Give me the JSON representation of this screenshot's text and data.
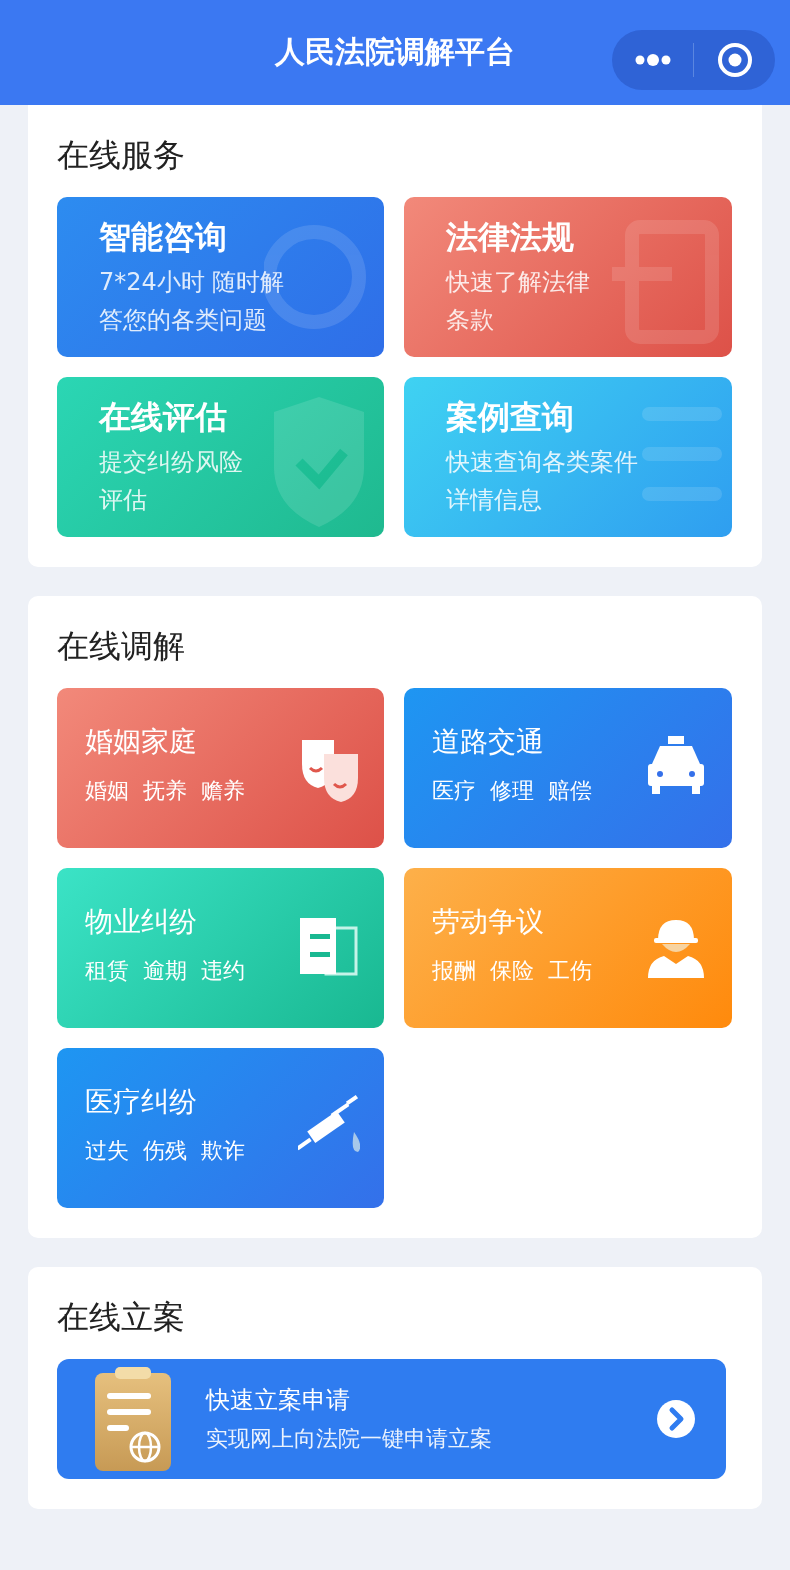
{
  "window": {
    "title": "人民法院调解平台"
  },
  "services": {
    "title": "在线服务",
    "tiles": [
      {
        "kind": "consult",
        "title": "智能咨询",
        "lines": [
          "7*24小时 随时解",
          "答您的各类问题"
        ]
      },
      {
        "kind": "law",
        "title": "法律法规",
        "lines": [
          "快速了解法律",
          "条款"
        ]
      },
      {
        "kind": "assess",
        "title": "在线评估",
        "lines": [
          "提交纠纷风险",
          "评估"
        ]
      },
      {
        "kind": "cases",
        "title": "案例查询",
        "lines": [
          "快速查询各类案件",
          "详情信息"
        ]
      }
    ]
  },
  "mediation": {
    "title": "在线调解",
    "tiles": [
      {
        "kind": "marriage",
        "title": "婚姻家庭",
        "tags": [
          "婚姻",
          "抚养",
          "赡养"
        ]
      },
      {
        "kind": "traffic",
        "title": "道路交通",
        "tags": [
          "医疗",
          "修理",
          "赔偿"
        ]
      },
      {
        "kind": "property",
        "title": "物业纠纷",
        "tags": [
          "租赁",
          "逾期",
          "违约"
        ]
      },
      {
        "kind": "labor",
        "title": "劳动争议",
        "tags": [
          "报酬",
          "保险",
          "工伤"
        ]
      },
      {
        "kind": "medical",
        "title": "医疗纠纷",
        "tags": [
          "过失",
          "伤残",
          "欺诈"
        ]
      }
    ]
  },
  "filing": {
    "title": "在线立案",
    "banner": {
      "title": "快速立案申请",
      "subtitle": "实现网上向法院一键申请立案"
    }
  }
}
